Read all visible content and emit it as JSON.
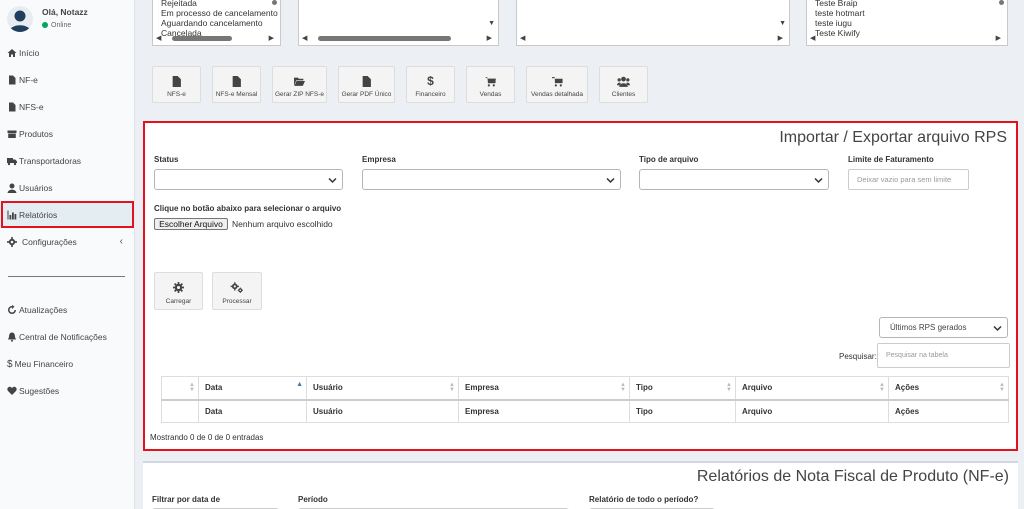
{
  "user": {
    "greeting": "Olá, Notazz",
    "status": "Online"
  },
  "sidebar": {
    "items": [
      {
        "label": "Início",
        "icon": "home-icon"
      },
      {
        "label": "NF-e",
        "icon": "file-icon"
      },
      {
        "label": "NFS-e",
        "icon": "file-icon"
      },
      {
        "label": "Produtos",
        "icon": "box-icon"
      },
      {
        "label": "Transportadoras",
        "icon": "truck-icon"
      },
      {
        "label": "Usuários",
        "icon": "user-icon"
      },
      {
        "label": "Relatórios",
        "icon": "bar-chart-icon",
        "active": true
      },
      {
        "label": "Configurações",
        "icon": "gear-icon"
      }
    ],
    "bottom_items": [
      {
        "label": "Atualizações",
        "icon": "refresh-icon"
      },
      {
        "label": "Central de Notificações",
        "icon": "bell-icon"
      },
      {
        "label": "Meu Financeiro",
        "icon": "dollar-icon"
      },
      {
        "label": "Sugestões",
        "icon": "heart-icon"
      }
    ]
  },
  "filters": {
    "status_list": [
      "Rejeitada",
      "Em processo de cancelamento",
      "Aguardando cancelamento",
      "Cancelada"
    ],
    "integration_list": [
      "Teste Braip",
      "teste hotmart",
      "teste iugu",
      "Teste Kiwify"
    ]
  },
  "report_buttons": [
    {
      "label": "NFS-e",
      "icon": "file-icon"
    },
    {
      "label": "NFS-e Mensal",
      "icon": "file-icon"
    },
    {
      "label": "Gerar ZIP NFS-e",
      "icon": "folder-open-icon"
    },
    {
      "label": "Gerar PDF Único",
      "icon": "file-icon"
    },
    {
      "label": "Financeiro",
      "icon": "dollar-icon"
    },
    {
      "label": "Vendas",
      "icon": "cart-icon"
    },
    {
      "label": "Vendas detalhada",
      "icon": "cart-icon"
    },
    {
      "label": "Clientes",
      "icon": "users-icon"
    }
  ],
  "rps": {
    "title": "Importar / Exportar arquivo RPS",
    "status_label": "Status",
    "empresa_label": "Empresa",
    "tipo_label": "Tipo de arquivo",
    "limite_label": "Limite de Faturamento",
    "limite_placeholder": "Deixar vazio para sem limite",
    "file_label": "Clique no botão abaixo para selecionar o arquivo",
    "file_button": "Escolher Arquivo",
    "file_status": "Nenhum arquivo escolhido",
    "carregar": "Carregar",
    "processar": "Processar",
    "ultimos": "Últimos RPS gerados",
    "search_label": "Pesquisar:",
    "search_placeholder": "Pesquisar na tabela",
    "columns": [
      "",
      "Data",
      "Usuário",
      "Empresa",
      "Tipo",
      "Arquivo",
      "Ações"
    ],
    "info": "Mostrando 0 de 0 de 0 entradas"
  },
  "nfe_report": {
    "title": "Relatórios de Nota Fiscal de Produto (NF-e)",
    "filter_label": "Filtrar por data de",
    "periodo_label": "Período",
    "todo_label": "Relatório de todo o período?"
  },
  "colors": {
    "highlight": "#e2131d",
    "sidebar_bg": "#f9fafc",
    "online": "#00a65a",
    "page_bg": "#ecf0f5"
  }
}
